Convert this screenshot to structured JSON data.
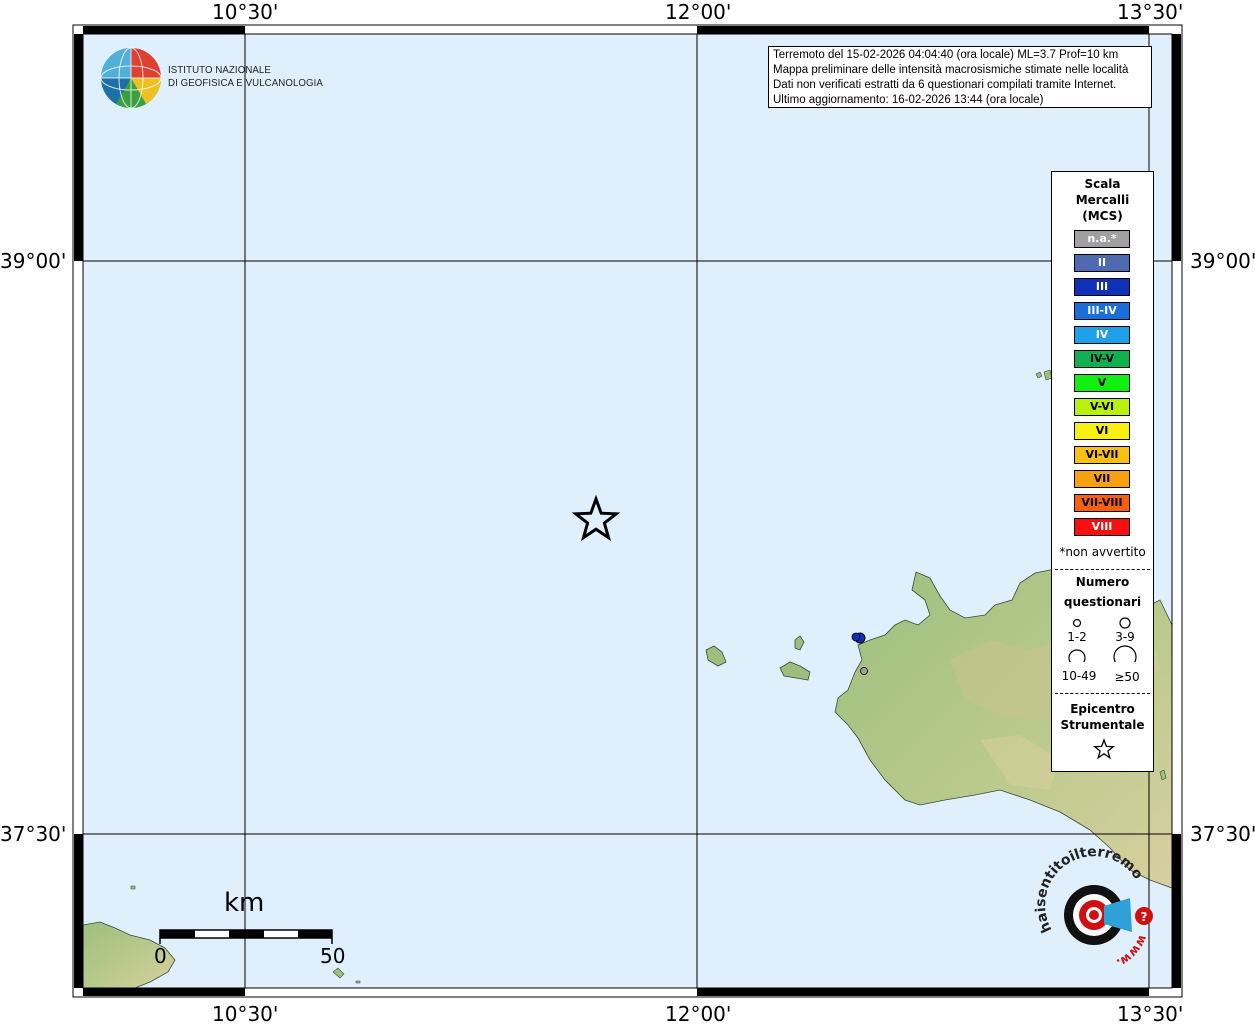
{
  "logo": {
    "line1": "ISTITUTO NAZIONALE",
    "line2": "DI GEOFISICA E VULCANOLOGIA",
    "icon": "ingv-globe-logo"
  },
  "info": {
    "line1": "Terremoto del 15-02-2026 04:04:40 (ora locale) ML=3.7 Prof=10 km",
    "line2": "Mappa preliminare delle intensità macrosismiche stimate nelle località",
    "line3": "Dati non verificati estratti da 6 questionari compilati tramite Internet.",
    "line4": "Ultimo aggiornamento: 16-02-2026 13:44 (ora locale)"
  },
  "axes": {
    "lon_ticks": [
      "10°30'",
      "12°00'",
      "13°30'"
    ],
    "lat_ticks": [
      "39°00'",
      "37°30'"
    ]
  },
  "legend": {
    "title_line1": "Scala",
    "title_line2": "Mercalli",
    "title_line3": "(MCS)",
    "intensities": [
      {
        "label": "n.a.*",
        "color": "#a0a0a0",
        "text": "#ffffff"
      },
      {
        "label": "II",
        "color": "#4f6ab0",
        "text": "#ffffff"
      },
      {
        "label": "III",
        "color": "#1030b8",
        "text": "#ffffff"
      },
      {
        "label": "III-IV",
        "color": "#1a6ed8",
        "text": "#ffffff"
      },
      {
        "label": "IV",
        "color": "#1ea0e8",
        "text": "#ffffff"
      },
      {
        "label": "IV-V",
        "color": "#10b050",
        "text": "#000000"
      },
      {
        "label": "V",
        "color": "#10f010",
        "text": "#000000"
      },
      {
        "label": "V-VI",
        "color": "#b8f010",
        "text": "#000000"
      },
      {
        "label": "VI",
        "color": "#f8f010",
        "text": "#000000"
      },
      {
        "label": "VI-VII",
        "color": "#f8c010",
        "text": "#000000"
      },
      {
        "label": "VII",
        "color": "#f8a010",
        "text": "#000000"
      },
      {
        "label": "VII-VIII",
        "color": "#f86010",
        "text": "#000000"
      },
      {
        "label": "VIII",
        "color": "#f81010",
        "text": "#ffffff"
      }
    ],
    "not_felt_note": "*non avvertito",
    "count_title_line1": "Numero",
    "count_title_line2": "questionari",
    "count_labels": [
      "1-2",
      "3-9",
      "10-49",
      "≥50"
    ],
    "epicenter_line1": "Epicentro",
    "epicenter_line2": "Strumentale"
  },
  "scale_bar": {
    "unit": "km",
    "start": "0",
    "end": "50"
  },
  "watermark": {
    "text_main": "haisentitoilterremoto.it",
    "text_www": "www.",
    "icon": "earthquake-report-logo"
  },
  "colors": {
    "sea": "#dff0fc",
    "land": "#8fb574",
    "frame": "#000000",
    "epicenter": "#000000"
  }
}
